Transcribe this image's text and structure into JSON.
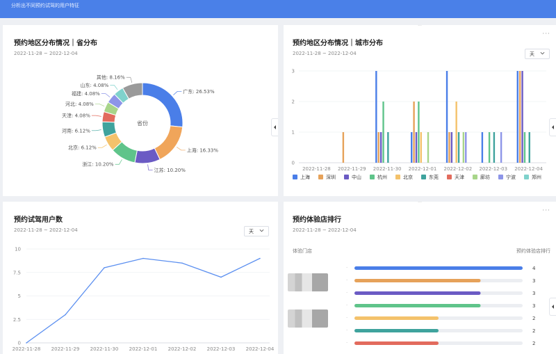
{
  "banner": {
    "text": "分析出不同预约试驾的用户特征"
  },
  "cards": {
    "province": {
      "title": "预约地区分布情况｜省分布",
      "date": "2022-11-28 ~ 2022-12-04",
      "center_label": "省份"
    },
    "city": {
      "title": "预约地区分布情况｜城市分布",
      "date": "2022-11-28 ~ 2022-12-04",
      "unit": "天",
      "more": "···",
      "legend": [
        {
          "name": "上海",
          "color": "#4a7ee8"
        },
        {
          "name": "深圳",
          "color": "#e6a25a"
        },
        {
          "name": "中山",
          "color": "#6b5bc4"
        },
        {
          "name": "杭州",
          "color": "#5fc48a"
        },
        {
          "name": "北京",
          "color": "#f4c26b"
        },
        {
          "name": "东莞",
          "color": "#3fa39d"
        },
        {
          "name": "天津",
          "color": "#e26b5d"
        },
        {
          "name": "廊坊",
          "color": "#a8d58a"
        },
        {
          "name": "宁波",
          "color": "#8d95e8"
        },
        {
          "name": "郑州",
          "color": "#7fd2cc"
        }
      ]
    },
    "users": {
      "title": "预约试驾用户数",
      "date": "2022-11-28 ~ 2022-12-04",
      "unit": "天"
    },
    "ranking": {
      "title": "预约体验店排行",
      "date": "2022-11-28 ~ 2022-12-04",
      "col_left": "体验门店",
      "col_right": "预约体验店排行",
      "more": "···"
    }
  },
  "chart_data": [
    {
      "type": "pie",
      "title": "预约地区分布情况｜省分布",
      "center_label": "省份",
      "slices": [
        {
          "name": "广东",
          "label": "广东: 26.53%",
          "value": 26.53,
          "color": "#4a7ee8"
        },
        {
          "name": "上海",
          "label": "上海: 16.33%",
          "value": 16.33,
          "color": "#f0a55a"
        },
        {
          "name": "江苏",
          "label": "江苏: 10.20%",
          "value": 10.2,
          "color": "#6b5bc4"
        },
        {
          "name": "浙江",
          "label": "浙江: 10.20%",
          "value": 10.2,
          "color": "#5fc48a"
        },
        {
          "name": "北京",
          "label": "北京: 6.12%",
          "value": 6.12,
          "color": "#f4c26b"
        },
        {
          "name": "河南",
          "label": "河南: 6.12%",
          "value": 6.12,
          "color": "#3fa39d"
        },
        {
          "name": "天津",
          "label": "天津: 4.08%",
          "value": 4.08,
          "color": "#e26b5d"
        },
        {
          "name": "河北",
          "label": "河北: 4.08%",
          "value": 4.08,
          "color": "#a8d58a"
        },
        {
          "name": "福建",
          "label": "福建: 4.08%",
          "value": 4.08,
          "color": "#8d95e8"
        },
        {
          "name": "山东",
          "label": "山东: 4.08%",
          "value": 4.08,
          "color": "#7fd2cc"
        },
        {
          "name": "其他",
          "label": "其他: 8.16%",
          "value": 8.16,
          "color": "#9a9a9a"
        }
      ]
    },
    {
      "type": "bar",
      "title": "预约地区分布情况｜城市分布",
      "categories": [
        "2022-11-28",
        "2022-11-29",
        "2022-11-30",
        "2022-12-01",
        "2022-12-02",
        "2022-12-03",
        "2022-12-04"
      ],
      "ylim": [
        0,
        3
      ],
      "yticks": [
        "0",
        "1",
        "2",
        "3"
      ],
      "series": [
        {
          "name": "上海",
          "color": "#4a7ee8",
          "values": [
            0,
            0,
            3,
            1,
            3,
            1,
            3
          ]
        },
        {
          "name": "深圳",
          "color": "#e6a25a",
          "values": [
            0,
            1,
            1,
            2,
            1,
            0,
            3
          ]
        },
        {
          "name": "中山",
          "color": "#6b5bc4",
          "values": [
            0,
            0,
            1,
            1,
            1,
            0,
            3
          ]
        },
        {
          "name": "杭州",
          "color": "#5fc48a",
          "values": [
            0,
            0,
            2,
            2,
            0,
            1,
            1
          ]
        },
        {
          "name": "北京",
          "color": "#f4c26b",
          "values": [
            0,
            0,
            0,
            1,
            2,
            0,
            0
          ]
        },
        {
          "name": "东莞",
          "color": "#3fa39d",
          "values": [
            0,
            0,
            1,
            0,
            1,
            1,
            1
          ]
        },
        {
          "name": "天津",
          "color": "#e26b5d",
          "values": [
            0,
            0,
            0,
            0,
            0,
            0,
            0
          ]
        },
        {
          "name": "廊坊",
          "color": "#a8d58a",
          "values": [
            0,
            0,
            0,
            1,
            1,
            0,
            0
          ]
        },
        {
          "name": "宁波",
          "color": "#8d95e8",
          "values": [
            0,
            0,
            0,
            0,
            1,
            1,
            0
          ]
        },
        {
          "name": "郑州",
          "color": "#7fd2cc",
          "values": [
            0,
            0,
            0,
            0,
            0,
            0,
            0
          ]
        }
      ]
    },
    {
      "type": "line",
      "title": "预约试驾用户数",
      "x": [
        "2022-11-28",
        "2022-11-29",
        "2022-11-30",
        "2022-12-01",
        "2022-12-02",
        "2022-12-03",
        "2022-12-04"
      ],
      "y": [
        0,
        3,
        8,
        9,
        8.5,
        7,
        9
      ],
      "ylim": [
        0,
        10
      ],
      "yticks": [
        "0",
        "2.5",
        "5",
        "7.5",
        "10"
      ],
      "color": "#5b8ff0"
    },
    {
      "type": "bar",
      "orientation": "horizontal",
      "title": "预约体验店排行",
      "max": 4,
      "values": [
        4,
        3,
        3,
        3,
        2,
        2,
        2
      ],
      "colors": [
        "#4a7ee8",
        "#e6a25a",
        "#6b5bc4",
        "#5fc48a",
        "#f4c26b",
        "#3fa39d",
        "#e26b5d"
      ]
    }
  ]
}
